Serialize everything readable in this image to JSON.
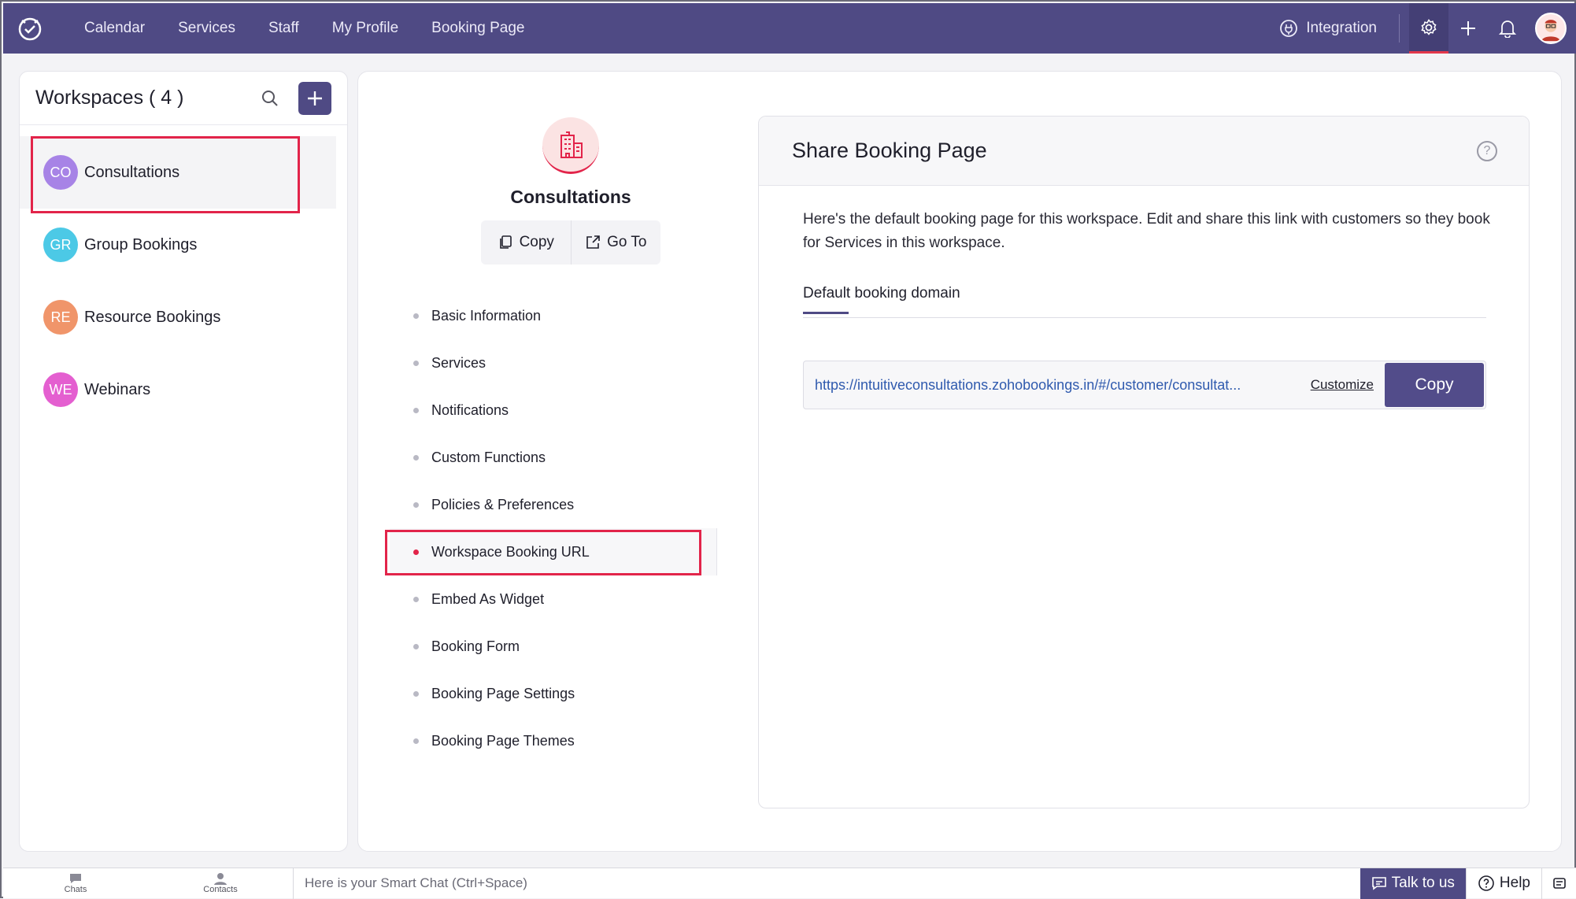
{
  "topnav": {
    "items": [
      "Calendar",
      "Services",
      "Staff",
      "My Profile",
      "Booking Page"
    ],
    "integration_label": "Integration"
  },
  "sidebar": {
    "title": "Workspaces ( 4 )",
    "workspaces": [
      {
        "initials": "CO",
        "name": "Consultations",
        "color": "#a783e6",
        "selected": true
      },
      {
        "initials": "GR",
        "name": "Group Bookings",
        "color": "#4cc9e6",
        "selected": false
      },
      {
        "initials": "RE",
        "name": "Resource Bookings",
        "color": "#f0956a",
        "selected": false
      },
      {
        "initials": "WE",
        "name": "Webinars",
        "color": "#e45fd0",
        "selected": false
      }
    ]
  },
  "workspace": {
    "name": "Consultations",
    "copy_label": "Copy",
    "goto_label": "Go To",
    "menu": [
      "Basic Information",
      "Services",
      "Notifications",
      "Custom Functions",
      "Policies & Preferences",
      "Workspace Booking URL",
      "Embed As Widget",
      "Booking Form",
      "Booking Page Settings",
      "Booking Page Themes"
    ],
    "active_menu": "Workspace Booking URL"
  },
  "share": {
    "title": "Share Booking Page",
    "description": "Here's the default booking page for this workspace. Edit and share this link with customers so they book for Services in this workspace.",
    "tab_label": "Default booking domain",
    "url": "https://intuitiveconsultations.zohobookings.in/#/customer/consultat...",
    "customize_label": "Customize",
    "copy_label": "Copy"
  },
  "bottombar": {
    "chats": "Chats",
    "contacts": "Contacts",
    "chat_placeholder": "Here is your Smart Chat (Ctrl+Space)",
    "talk_label": "Talk to us",
    "help_label": "Help"
  },
  "colors": {
    "brand": "#4f4a84",
    "highlight": "#e2244a"
  }
}
